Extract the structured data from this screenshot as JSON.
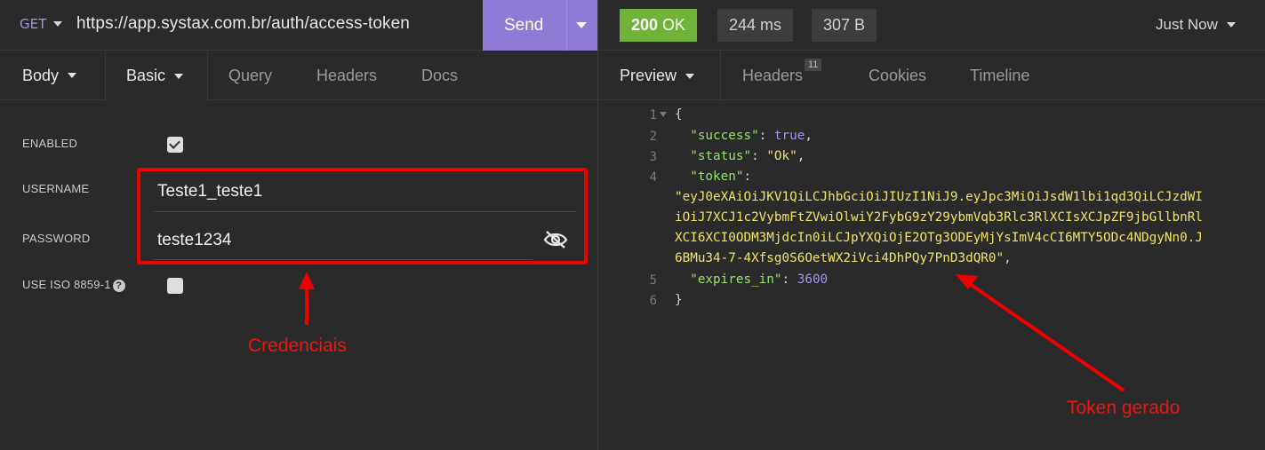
{
  "request": {
    "method": "GET",
    "url": "https://app.systax.com.br/auth/access-token",
    "send_label": "Send",
    "tabs": [
      {
        "label": "Body"
      },
      {
        "label": "Basic"
      },
      {
        "label": "Query"
      },
      {
        "label": "Headers"
      },
      {
        "label": "Docs"
      }
    ],
    "auth": {
      "enabled_label": "ENABLED",
      "enabled": true,
      "username_label": "USERNAME",
      "username_value": "Teste1_teste1",
      "password_label": "PASSWORD",
      "password_value": "teste1234",
      "iso_label": "USE ISO 8859-1",
      "iso_help": "?",
      "iso_enabled": false
    }
  },
  "response": {
    "status_code": "200",
    "status_text": "OK",
    "time": "244 ms",
    "size": "307 B",
    "history_label": "Just Now",
    "tabs": [
      {
        "label": "Preview"
      },
      {
        "label": "Headers",
        "badge": "11"
      },
      {
        "label": "Cookies"
      },
      {
        "label": "Timeline"
      }
    ],
    "line_numbers": [
      "1",
      "2",
      "3",
      "4",
      "5",
      "6"
    ],
    "json": {
      "open_brace": "{",
      "close_brace": "}",
      "success_key": "\"success\"",
      "success_value": "true",
      "status_key": "\"status\"",
      "status_value": "\"Ok\"",
      "token_key": "\"token\"",
      "token_lines": [
        "\"eyJ0eXAiOiJKV1QiLCJhbGciOiJIUzI1NiJ9.eyJpc3MiOiJsdW1lbi1qd3QiLCJzdWI",
        "iOiJ7XCJ1c2VybmFtZVwiOlwiY2FybG9zY29ybmVqb3Rlc3RlXCIsXCJpZF9jbGllbnRl",
        "XCI6XCI0ODM3MjdcIn0iLCJpYXQiOjE2OTg3ODEyMjYsImV4cCI6MTY5ODc4NDgyNn0.J",
        "6BMu34-7-4Xfsg0S6OetWX2iVci4DhPQy7PnD3dQR0\""
      ],
      "expires_key": "\"expires_in\"",
      "expires_value": "3600"
    }
  },
  "annotations": {
    "credentials_label": "Credenciais",
    "token_label": "Token gerado",
    "color": "#ef0000"
  },
  "colors": {
    "accent": "#8f7ad6",
    "status_ok": "#6fb33a",
    "background": "#2a2a2a"
  }
}
